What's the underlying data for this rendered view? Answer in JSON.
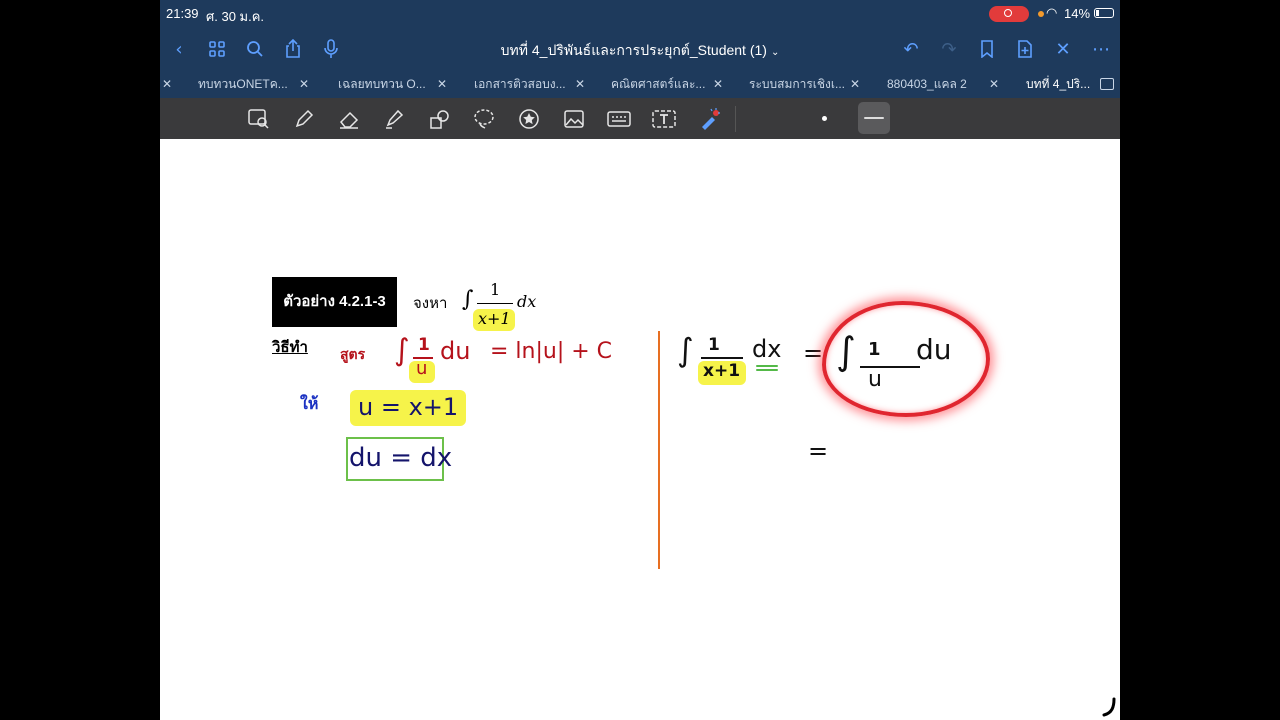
{
  "status": {
    "time": "21:39",
    "date": "ศ. 30 ม.ค.",
    "battery": "14%"
  },
  "nav": {
    "title": "บทที่ 4_ปริพันธ์และการประยุกต์_Student (1)",
    "chevron": "⌄"
  },
  "tabs": [
    {
      "label": "ทบทวนONETค..."
    },
    {
      "label": "เฉลยทบทวน O..."
    },
    {
      "label": "เอกสารติวสอบง..."
    },
    {
      "label": "คณิตศาสตร์และ..."
    },
    {
      "label": "ระบบสมการเชิงเ..."
    },
    {
      "label": "880403_แคล 2"
    },
    {
      "label": "บทที่ 4_ปริ..."
    }
  ],
  "toolbar": {
    "icons": [
      "zoom-lasso-icon",
      "pen-icon",
      "eraser-icon",
      "highlighter-icon",
      "shapes-icon",
      "lasso-icon",
      "sticker-icon",
      "image-icon",
      "keyboard-icon",
      "textbox-icon",
      "laser-pointer-icon"
    ]
  },
  "page": {
    "example_label": "ตัวอย่าง 4.2.1-3",
    "find_text": "จงหา",
    "integral_sign": "∫",
    "frac_num": "1",
    "frac_den": "x+1",
    "dx": "dx",
    "method_label": "วิธีทำ",
    "formula_label": "สูตร",
    "formula": "∫",
    "formula_num": "1",
    "formula_den": "u",
    "formula_du": "du",
    "formula_eq": "= ln|u| + C",
    "let_label": "ให้",
    "sub_u": "u =  x+1",
    "sub_du": "du = dx",
    "right_integral": "∫",
    "right_num": "1",
    "right_den": "x+1",
    "right_dx": "dx",
    "right_eq": "=",
    "right_result_int": "∫",
    "right_result_num": "1",
    "right_result_den": "u",
    "right_result_du": "du",
    "right_eq2": "="
  },
  "colors": {
    "bar": "#1e3a5c",
    "toolbar": "#3a3a3c",
    "accent": "#5e9fff",
    "divider": "#e76f22",
    "highlight": "#f6f34a"
  }
}
